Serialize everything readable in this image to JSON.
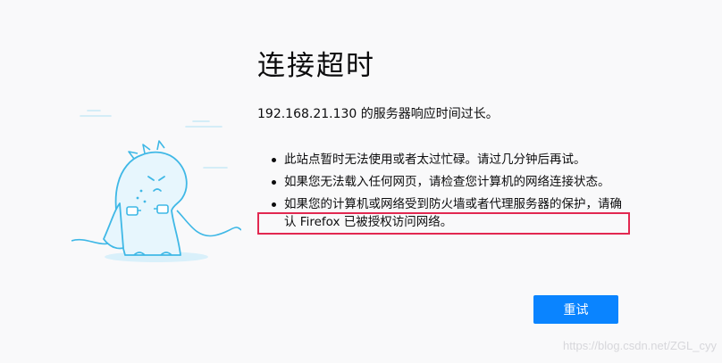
{
  "error": {
    "title": "连接超时",
    "description": "192.168.21.130 的服务器响应时间过长。",
    "suggestions": [
      "此站点暂时无法使用或者太过忙碌。请过几分钟后再试。",
      "如果您无法载入任何网页，请检查您计算机的网络连接状态。",
      "如果您的计算机或网络受到防火墙或者代理服务器的保护，请确认 Firefox 已被授权访问网络。"
    ]
  },
  "actions": {
    "retry_label": "重试"
  },
  "watermark": "https://blog.csdn.net/ZGL_cyy",
  "colors": {
    "accent": "#0a84ff",
    "highlight": "#e22850",
    "illustration_stroke": "#3fb8e6",
    "illustration_fill": "#e7f6fd"
  },
  "icons": {
    "illustration": "unplugged-dinosaur-illustration"
  }
}
